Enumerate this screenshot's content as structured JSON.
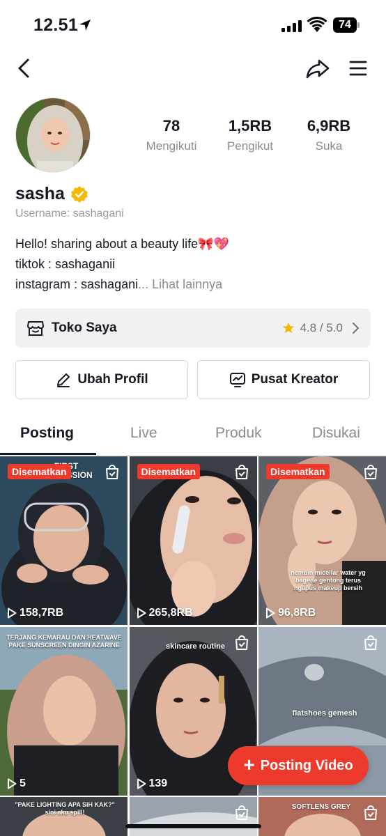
{
  "status_bar": {
    "time": "12.51",
    "battery": "74"
  },
  "profile": {
    "name": "sasha",
    "username": "Username: sashagani",
    "stats": [
      {
        "value": "78",
        "label": "Mengikuti"
      },
      {
        "value": "1,5RB",
        "label": "Pengikut"
      },
      {
        "value": "6,9RB",
        "label": "Suka"
      }
    ],
    "bio": {
      "line1": "Hello! sharing about a beauty life🎀💖",
      "line2": "tiktok : sashaganii",
      "line3": "instagram : sashagani",
      "more": "... Lihat lainnya"
    }
  },
  "shop": {
    "label": "Toko Saya",
    "rating": "4.8 / 5.0"
  },
  "buttons": {
    "edit": "Ubah Profil",
    "creator": "Pusat Kreator"
  },
  "tabs": [
    "Posting",
    "Live",
    "Produk",
    "Disukai"
  ],
  "videos": [
    {
      "pinned": "Disematkan",
      "views": "158,7RB",
      "caption": "FIRST IMPRESSION"
    },
    {
      "pinned": "Disematkan",
      "views": "265,8RB",
      "caption": ""
    },
    {
      "pinned": "Disematkan",
      "views": "96,8RB",
      "caption": "nemuin micellar water yg bagede gentong terus ngapus makeup bersih"
    },
    {
      "views": "5",
      "caption": "TERJANG KEMARAU DAN HEATWAVE PAKE SUNSCREEN DINGIN AZARINE"
    },
    {
      "views": "139",
      "caption": "skincare routine"
    },
    {
      "views": "",
      "caption": "flatshoes gemesh"
    },
    {
      "caption": "\"PAKE LIGHTING APA SIH KAK?\" sini aku spill!"
    },
    {
      "caption": ""
    },
    {
      "caption": "SOFTLENS GREY"
    }
  ],
  "fab": {
    "label": "Posting Video"
  },
  "colors": {
    "accent": "#ee3a2c",
    "verified": "#f5b800"
  }
}
